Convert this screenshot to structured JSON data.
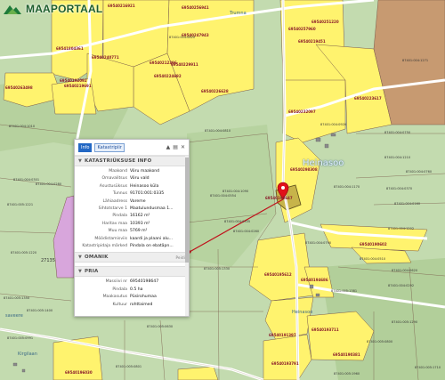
{
  "app": {
    "logo_text": "MAAPORTAAL"
  },
  "map": {
    "place_names": [
      {
        "id": "heinasoo",
        "text": "Heinasoo"
      },
      {
        "id": "trumna",
        "text": "Trumna"
      },
      {
        "id": "heinasoo-small",
        "text": "Heinasoo"
      },
      {
        "id": "kirgilaan",
        "text": "Kirgilaan"
      },
      {
        "id": "saveere",
        "text": "saveere"
      }
    ],
    "parcel_ids": [
      "69540216921",
      "69540256941",
      "69540247943",
      "69541804361",
      "69540240771",
      "69540257960",
      "69540251220",
      "69540212396",
      "69540229911",
      "69540219691",
      "69540192092",
      "69540263498",
      "69540224692",
      "69540219451",
      "69540232097",
      "69540226628",
      "69540223617",
      "69540298308",
      "69540198647",
      "69540190602",
      "69540195612",
      "69540194686",
      "69540191397",
      "69540193711",
      "69540190381",
      "69540196030",
      "69540193791"
    ],
    "cadastre_codes": [
      "87401:004:0820",
      "87401:004:1010",
      "87401:004:0810",
      "87401:004:0301",
      "87401:004:0280",
      "87401:004:0920",
      "87401:004:1210",
      "87401:004:0760",
      "87401:004:1271",
      "87401:004:1170",
      "87401:004:0370",
      "87401:004:0750",
      "87401:004:0160",
      "87401:004:0620",
      "87401:004:0510",
      "87401:004:0790",
      "87401:004:0260",
      "87401:004:1090",
      "87401:004:0292",
      "87401:005:1221",
      "87401:005:1220",
      "87401:005:1350",
      "87401:005:1400",
      "87401:005:1330",
      "87401:005:1381",
      "87401:004:0335",
      "87401:004:0554",
      "87401:004:1202",
      "87401:005:0991",
      "87401:005:0630",
      "87401:005:1290",
      "87401:005:0800",
      "87401:005:1710",
      "87401:005:0801",
      "87401:005:1960"
    ],
    "other_labels": [
      "27135",
      "Heinasoo"
    ]
  },
  "popup": {
    "tabs": [
      {
        "label": "Info",
        "active": true
      },
      {
        "label": "Katastripiir",
        "active": false
      }
    ],
    "cadastre_section": {
      "title": "KATASTRIÜKSUSE INFO",
      "rows": [
        {
          "key": "Maakond",
          "value": "Võru maakond"
        },
        {
          "key": "Omavalitsus",
          "value": "Võru vald"
        },
        {
          "key": "Asustusüksus",
          "value": "Heinasoo küla"
        },
        {
          "key": "Tunnus",
          "value": "91701:001:0335"
        },
        {
          "key": "Lähiaadress",
          "value": "Vareme"
        },
        {
          "key": "Sihtotstarve 1",
          "value": "Maatulundusmaa 1..."
        },
        {
          "key": "Pindala",
          "value": "16162 m²"
        },
        {
          "key": "Haritav maa",
          "value": "10393 m²"
        },
        {
          "key": "Muu maa",
          "value": "5769 m²"
        },
        {
          "key": "Mõõdistamisviis",
          "value": "kaardi ja plaani alu..."
        },
        {
          "key": "Katastripidaja märked",
          "value": "Pindala on ebatäpn..."
        }
      ]
    },
    "owner_section": {
      "title": "OMANIK",
      "aside": "Peidi"
    },
    "pria_section": {
      "title": "PRIA",
      "rows": [
        {
          "key": "Massiivi nr",
          "value": "69540198647"
        },
        {
          "key": "Pindala",
          "value": "0.5 ha"
        },
        {
          "key": "Maakasutus",
          "value": "Püsirohumaa"
        },
        {
          "key": "Kultuur",
          "value": "rohttaimed"
        }
      ]
    }
  },
  "colors": {
    "forest": "#bcd6a6",
    "field": "#fff36e",
    "parcel_border": "#7a5a4a",
    "road": "#ffffff",
    "purple_area": "#d8a6dc",
    "brown_area": "#c79a71",
    "marker": "#e0101a",
    "pointer_line": "#c0101a",
    "highlight": "#c7b44a"
  }
}
